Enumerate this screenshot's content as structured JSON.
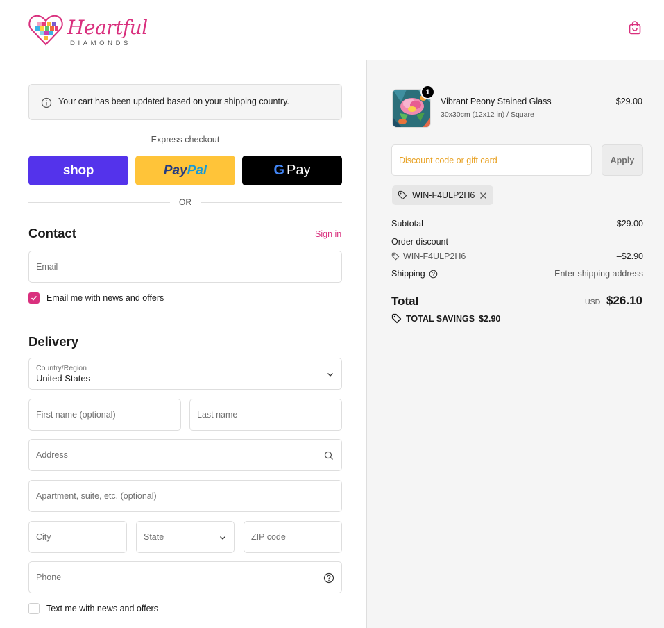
{
  "brand": {
    "name": "Heartful",
    "sub": "DIAMONDS",
    "accent": "#d9307e"
  },
  "header": {
    "cart_icon": "shopping-bag-icon"
  },
  "notice": {
    "icon": "info-icon",
    "text": "Your cart has been updated based on your shipping country."
  },
  "express": {
    "title": "Express checkout",
    "shop_label": "shop",
    "paypal_label_a": "Pay",
    "paypal_label_b": "Pal",
    "gpay_g": "G",
    "gpay_label": "Pay",
    "or_text": "OR"
  },
  "contact": {
    "title": "Contact",
    "sign_in": "Sign in",
    "email_placeholder": "Email",
    "news_label": "Email me with news and offers",
    "news_checked": true
  },
  "delivery": {
    "title": "Delivery",
    "country_label": "Country/Region",
    "country_value": "United States",
    "first_name_placeholder": "First name (optional)",
    "last_name_placeholder": "Last name",
    "address_placeholder": "Address",
    "apartment_placeholder": "Apartment, suite, etc. (optional)",
    "city_placeholder": "City",
    "state_placeholder": "State",
    "zip_placeholder": "ZIP code",
    "phone_placeholder": "Phone",
    "sms_label": "Text me with news and offers",
    "sms_checked": false
  },
  "order": {
    "item": {
      "name": "Vibrant Peony Stained Glass",
      "variant": "30x30cm (12x12 in) / Square",
      "price": "$29.00",
      "quantity": "1"
    },
    "discount_placeholder": "Discount code or gift card",
    "apply_label": "Apply",
    "applied_code": "WIN-F4ULP2H6",
    "summary": {
      "subtotal_label": "Subtotal",
      "subtotal_value": "$29.00",
      "order_discount_label": "Order discount",
      "discount_code": "WIN-F4ULP2H6",
      "discount_value": "–$2.90",
      "shipping_label": "Shipping",
      "shipping_value": "Enter shipping address",
      "total_label": "Total",
      "currency": "USD",
      "total_value": "$26.10",
      "savings_label": "TOTAL SAVINGS",
      "savings_value": "$2.90"
    }
  }
}
